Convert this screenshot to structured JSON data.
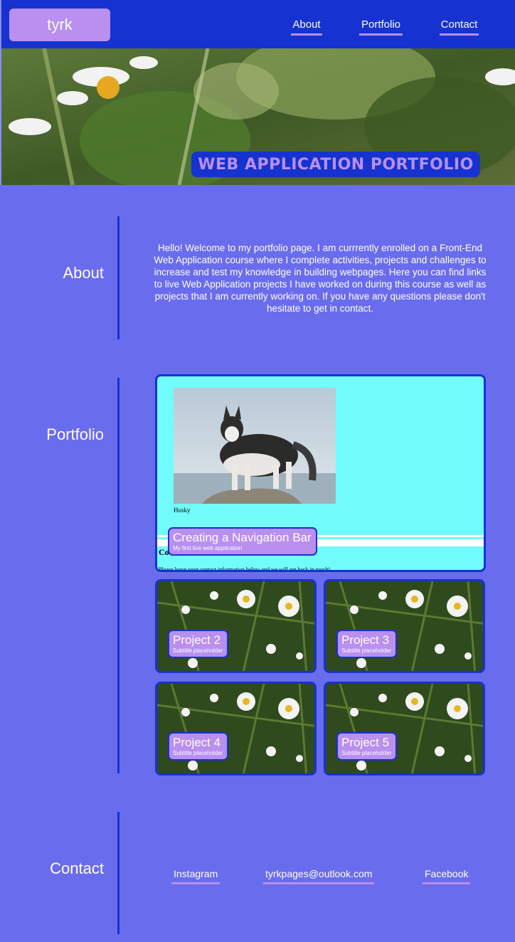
{
  "header": {
    "logo": "tyrk",
    "nav": [
      "About",
      "Portfolio",
      "Contact"
    ]
  },
  "hero": {
    "title": "WEB APPLICATION PORTFOLIO"
  },
  "about": {
    "heading": "About",
    "text": "Hello! Welcome to my portfolio page. I am currrently enrolled on a Front-End Web Application course where I complete activities, projects and challenges to increase and test my knowledge in building webpages. Here you can find links to live Web Application projects I have worked on during this course as well as projects that I am currently working on. If you have any questions please don't hesitate to get in contact."
  },
  "portfolio": {
    "heading": "Portfolio",
    "featured": {
      "title": "Creating a Navigation Bar",
      "subtitle": "My first live web application",
      "preview": {
        "image_caption": "Husky",
        "heading_fragment": "Co",
        "contact_line": "Please leave your contact information below and we will get back in touch!"
      }
    },
    "projects": [
      {
        "title": "Project 2",
        "subtitle": "Subtitle placeholder"
      },
      {
        "title": "Project 3",
        "subtitle": "Subtitle placeholder"
      },
      {
        "title": "Project 4",
        "subtitle": "Subtitle placeholder"
      },
      {
        "title": "Project 5",
        "subtitle": "Subtitle placeholder"
      }
    ]
  },
  "contact": {
    "heading": "Contact",
    "links": [
      "Instagram",
      "tyrkpages@outlook.com",
      "Facebook"
    ]
  },
  "colors": {
    "page_bg": "#6a6cee",
    "header_bg": "#1632d0",
    "accent": "#b98ff0",
    "preview_bg": "#72fbfb"
  }
}
